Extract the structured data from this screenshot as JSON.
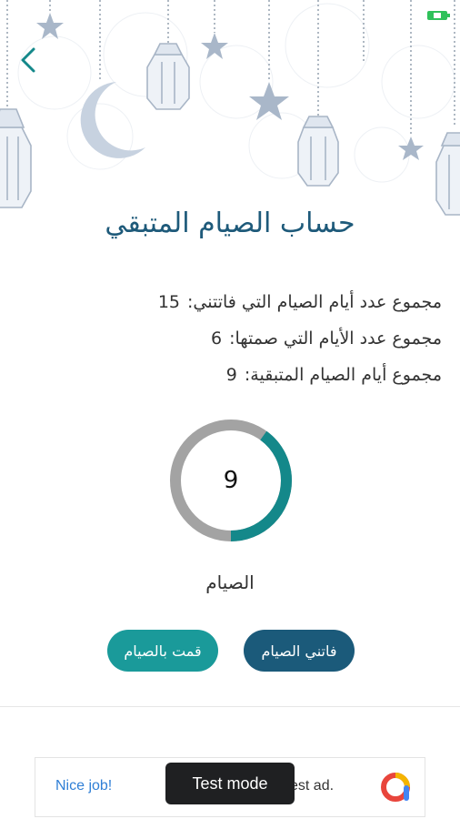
{
  "header": {
    "title": "حساب الصيام المتبقي"
  },
  "stats": [
    {
      "label": "مجموع عدد أيام الصيام التي فاتتني:",
      "value": "15"
    },
    {
      "label": "مجموع عدد الأيام التي صمتها:",
      "value": "6"
    },
    {
      "label": "مجموع أيام الصيام المتبقية:",
      "value": "9"
    }
  ],
  "gauge": {
    "value": "9",
    "label": "الصيام",
    "completed_fraction": 0.4,
    "progress_color": "#14888a",
    "track_color": "#a3a3a3"
  },
  "buttons": {
    "missed": "فاتني الصيام",
    "fasted": "قمت بالصيام"
  },
  "ad": {
    "nice_text": "Nice job!",
    "test_text": "est ad."
  },
  "toast": {
    "text": "Test mode"
  },
  "colors": {
    "title": "#1e5a7a",
    "accent_dark": "#1b5a7a",
    "accent_teal": "#1a9a9a",
    "decor": "#b8c6d8"
  }
}
